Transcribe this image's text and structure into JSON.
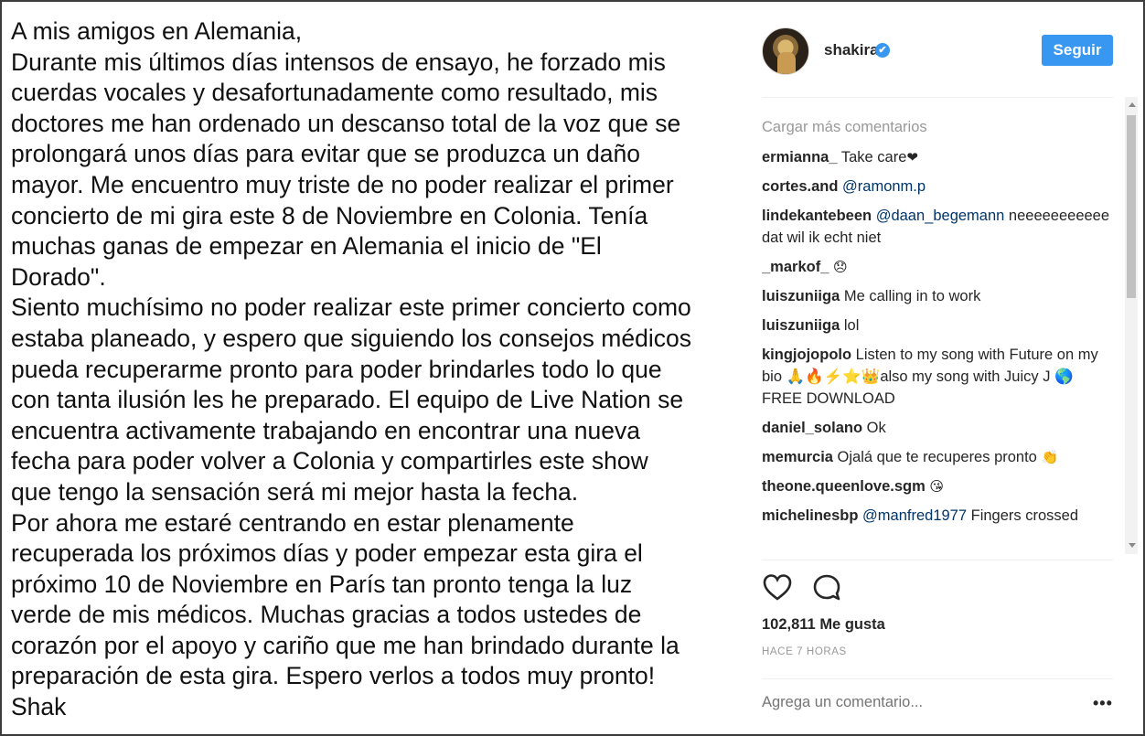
{
  "post": {
    "text_lines": [
      "A mis amigos en Alemania,",
      "Durante mis últimos días intensos de ensayo, he forzado mis",
      "cuerdas vocales y desafortunadamente como resultado, mis",
      "doctores me han ordenado un descanso total de la voz que se",
      "prolongará unos días para evitar que se produzca un daño",
      "mayor. Me encuentro muy triste de no poder realizar el primer",
      "concierto de mi gira este 8 de Noviembre en Colonia. Tenía",
      "muchas ganas de empezar en Alemania el inicio de \"El",
      "Dorado\".",
      "Siento muchísimo no poder realizar este primer concierto como",
      "estaba planeado, y espero que siguiendo los consejos médicos",
      "pueda recuperarme pronto para poder brindarles todo lo que",
      "con tanta ilusión les he preparado. El equipo de Live Nation se",
      "encuentra activamente trabajando en encontrar una nueva",
      "fecha para poder volver a Colonia y compartirles este show",
      "que tengo la sensación será mi mejor hasta la fecha.",
      "Por ahora me estaré centrando en estar plenamente",
      "recuperada los próximos días y poder empezar esta gira el",
      "próximo 10 de Noviembre en París tan pronto tenga la luz",
      "verde de mis médicos. Muchas gracias a todos ustedes de",
      "corazón por el apoyo y cariño que me han brindado durante la",
      "preparación de esta gira. Espero verlos a todos muy pronto!",
      "Shak"
    ]
  },
  "header": {
    "username": "shakira",
    "verified_icon": "✔",
    "follow_label": "Seguir"
  },
  "comments": {
    "load_more": "Cargar más comentarios",
    "items": [
      {
        "user": "ermianna_",
        "mention": "",
        "text": " Take care",
        "emoji": "❤"
      },
      {
        "user": "cortes.and",
        "mention": " @ramonm.p",
        "text": "",
        "emoji": ""
      },
      {
        "user": "lindekantebeen",
        "mention": " @daan_begemann",
        "text": " neeeeeeeeeee dat wil ik echt niet",
        "emoji": ""
      },
      {
        "user": "_markof_",
        "mention": "",
        "text": " ",
        "emoji": "😞"
      },
      {
        "user": "luiszuniiga",
        "mention": "",
        "text": " Me calling in to work",
        "emoji": ""
      },
      {
        "user": "luiszuniiga",
        "mention": "",
        "text": " lol",
        "emoji": ""
      },
      {
        "user": "kingjojopolo",
        "mention": "",
        "text": " Listen to my song with Future on my bio 🙏🔥⚡⭐👑also my song with Juicy J 🌎 FREE DOWNLOAD",
        "emoji": ""
      },
      {
        "user": "daniel_solano",
        "mention": "",
        "text": " Ok",
        "emoji": ""
      },
      {
        "user": "memurcia",
        "mention": "",
        "text": " Ojalá que te recuperes pronto ",
        "emoji": "👏"
      },
      {
        "user": "theone.queenlove.sgm",
        "mention": "",
        "text": " ",
        "emoji": "😘"
      },
      {
        "user": "michelinesbp",
        "mention": " @manfred1977",
        "text": " Fingers crossed",
        "emoji": ""
      }
    ]
  },
  "footer": {
    "likes": "102,811 Me gusta",
    "time": "HACE 7 HORAS",
    "add_comment_placeholder": "Agrega un comentario...",
    "more_label": "•••"
  }
}
